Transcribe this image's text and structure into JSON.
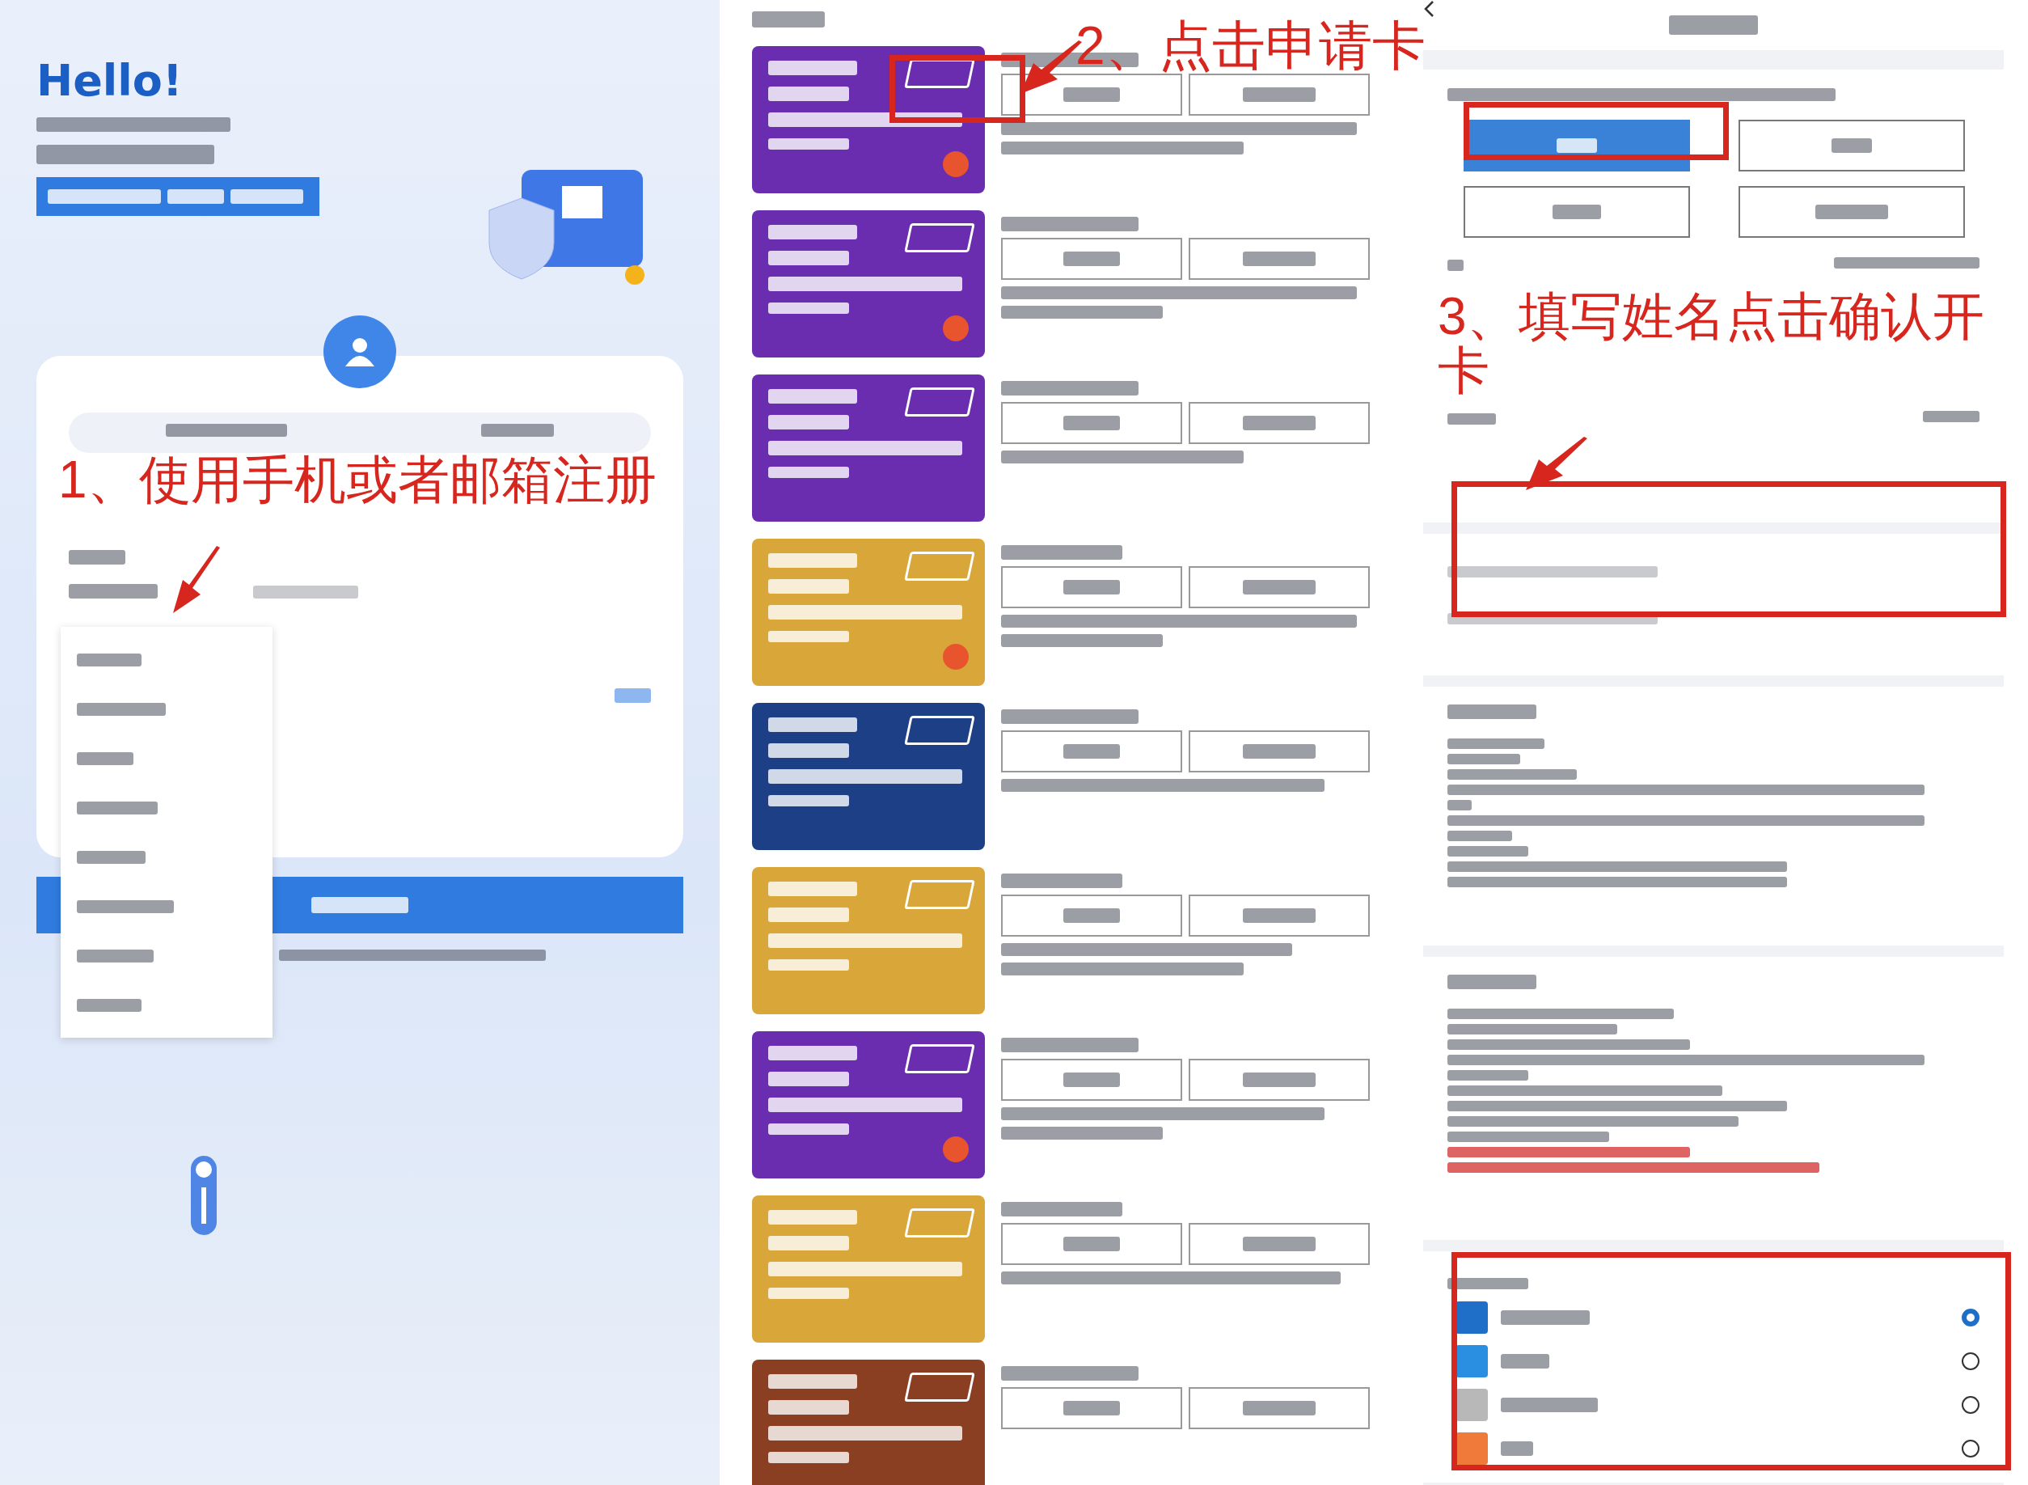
{
  "login": {
    "greeting": "Hello!"
  },
  "annotations": [
    {
      "text": "1、使用手机或者邮箱注册"
    },
    {
      "text": "2、点击申请卡"
    },
    {
      "text": "3、填写姓名点击确认开卡"
    }
  ],
  "cards": [
    {
      "color": "#6a2db0"
    },
    {
      "color": "#6a2db0"
    },
    {
      "color": "#6a2db0"
    },
    {
      "color": "#d9a63a"
    },
    {
      "color": "#1d3f86"
    },
    {
      "color": "#d9a63a"
    },
    {
      "color": "#6a2db0"
    },
    {
      "color": "#d9a63a"
    },
    {
      "color": "#8a3e22"
    }
  ],
  "amount_options": [
    {
      "selected": true
    },
    {
      "selected": false
    },
    {
      "selected": false
    },
    {
      "selected": false
    }
  ],
  "payment_methods": [
    {
      "selected": true,
      "color": "#1f6fc8"
    },
    {
      "selected": false,
      "color": "#2a8fe0"
    },
    {
      "selected": false,
      "color": "#b8b8b8"
    },
    {
      "selected": false,
      "color": "#ef7a3a"
    }
  ]
}
